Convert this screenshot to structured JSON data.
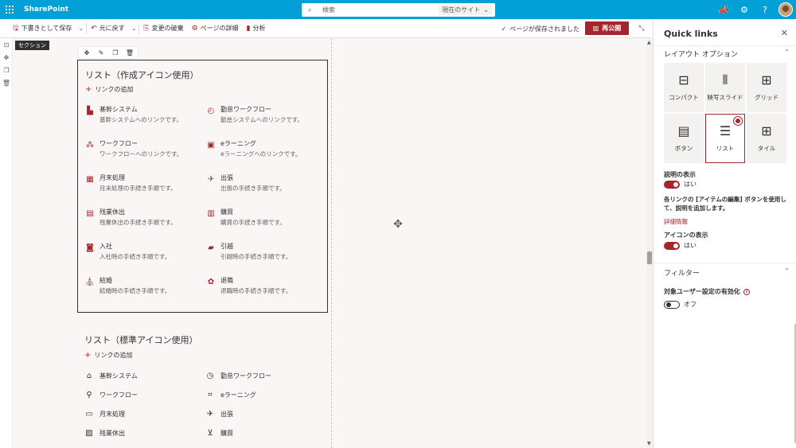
{
  "suitebar": {
    "brand": "SharePoint",
    "search_placeholder": "検索",
    "search_scope": "現在のサイト"
  },
  "cmdbar": {
    "save_draft": "下書きとして保存",
    "undo": "元に戻す",
    "discard": "変更の破棄",
    "page_details": "ページの詳細",
    "analytics": "分析",
    "saved_status": "ページが保存されました",
    "republish": "再公開"
  },
  "canvas": {
    "section_tag": "セクション"
  },
  "webpart1": {
    "title": "リスト（作成アイコン使用）",
    "add_link": "リンクの追加",
    "items": [
      {
        "title": "基幹システム",
        "desc": "基幹システムへのリンクです。",
        "icon": "building-icon"
      },
      {
        "title": "勤怠ワークフロー",
        "desc": "勤怠システムへのリンクです。",
        "icon": "clock-icon"
      },
      {
        "title": "ワークフロー",
        "desc": "ワークフローへのリンクです。",
        "icon": "workflow-icon"
      },
      {
        "title": "eラーニング",
        "desc": "eラーニングへのリンクです。",
        "icon": "elearning-icon"
      },
      {
        "title": "月末処理",
        "desc": "月末処理の手続き手順です。",
        "icon": "calendar-icon"
      },
      {
        "title": "出張",
        "desc": "出張の手続き手順です。",
        "icon": "airplane-icon"
      },
      {
        "title": "残業休出",
        "desc": "残業休出の手続き手順です。",
        "icon": "overtime-icon"
      },
      {
        "title": "購買",
        "desc": "購買の手続き手順です。",
        "icon": "cart-icon"
      },
      {
        "title": "入社",
        "desc": "入社時の手続き手順です。",
        "icon": "person-icon"
      },
      {
        "title": "引越",
        "desc": "引越時の手続き手順です。",
        "icon": "truck-icon"
      },
      {
        "title": "結婚",
        "desc": "結婚時の手続き手順です。",
        "icon": "wedding-icon"
      },
      {
        "title": "退職",
        "desc": "退職時の手続き手順です。",
        "icon": "farewell-icon"
      }
    ]
  },
  "webpart2": {
    "title": "リスト（標準アイコン使用）",
    "add_link": "リンクの追加",
    "items": [
      {
        "title": "基幹システム",
        "icon": "building-icon"
      },
      {
        "title": "勤怠ワークフロー",
        "icon": "clock-icon"
      },
      {
        "title": "ワークフロー",
        "icon": "flow-icon"
      },
      {
        "title": "eラーニング",
        "icon": "graduation-cap-icon"
      },
      {
        "title": "月末処理",
        "icon": "card-icon"
      },
      {
        "title": "出張",
        "icon": "airplane-icon"
      },
      {
        "title": "残業休出",
        "icon": "overtime-icon"
      },
      {
        "title": "購買",
        "icon": "cart-icon"
      }
    ]
  },
  "pane": {
    "title": "Quick links",
    "layout_section": "レイアウト オプション",
    "layouts": [
      {
        "label": "コンパクト",
        "icon": "compact-icon",
        "selected": false
      },
      {
        "label": "映写スライド",
        "icon": "filmstrip-icon",
        "selected": false
      },
      {
        "label": "グリッド",
        "icon": "grid-icon",
        "selected": false
      },
      {
        "label": "ボタン",
        "icon": "button-icon",
        "selected": false
      },
      {
        "label": "リスト",
        "icon": "list-icon",
        "selected": true
      },
      {
        "label": "タイル",
        "icon": "tile-icon",
        "selected": false
      }
    ],
    "show_desc_label": "説明の表示",
    "show_desc_state": "はい",
    "desc_help": "各リンクの [アイテムの編集] ボタンを使用して、説明を追加します。",
    "more_info": "詳細情報",
    "show_icons_label": "アイコンの表示",
    "show_icons_state": "はい",
    "filter_section": "フィルター",
    "audience_label": "対象ユーザー設定の有効化",
    "audience_state": "オフ"
  },
  "colors": {
    "suitebar": "#03a0d8",
    "accent": "#a4262c"
  }
}
